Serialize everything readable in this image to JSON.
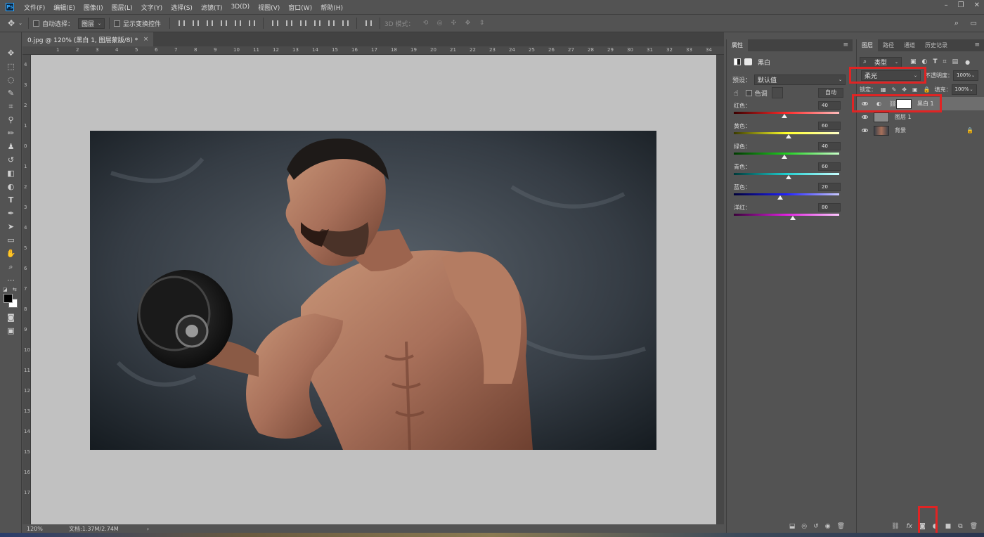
{
  "menubar": {
    "logo": "Ps",
    "items": [
      "文件(F)",
      "编辑(E)",
      "图像(I)",
      "图层(L)",
      "文字(Y)",
      "选择(S)",
      "滤镜(T)",
      "3D(D)",
      "视图(V)",
      "窗口(W)",
      "帮助(H)"
    ]
  },
  "options": {
    "auto_select_label": "自动选择：",
    "auto_select_value": "图层",
    "show_transform_label": "显示变换控件",
    "mode_3d_label": "3D 模式："
  },
  "document": {
    "tab_title": "0.jpg @ 120% (黑白 1, 图层蒙版/8) *",
    "zoom": "120%",
    "doc_info": "文档:1.37M/2.74M",
    "ruler_h": [
      "1",
      "2",
      "3",
      "4",
      "5",
      "6",
      "7",
      "8",
      "9",
      "10",
      "11",
      "12",
      "13",
      "14",
      "15",
      "16",
      "17",
      "18",
      "19",
      "20",
      "21",
      "22",
      "23",
      "24",
      "25",
      "26",
      "27",
      "28",
      "29",
      "30",
      "31",
      "32",
      "33",
      "34",
      "35"
    ],
    "ruler_v": [
      "4",
      "3",
      "2",
      "1",
      "0",
      "1",
      "2",
      "3",
      "4",
      "5",
      "6",
      "7",
      "8",
      "9",
      "10",
      "11",
      "12",
      "13",
      "14",
      "15",
      "16",
      "17"
    ]
  },
  "properties": {
    "tab": "属性",
    "adjustment_name": "黑白",
    "preset_label": "预设：",
    "preset_value": "默认值",
    "tint_label": "色调",
    "auto_button": "自动",
    "sliders": [
      {
        "label": "红色：",
        "value": "40",
        "fraction": 0.48,
        "gradient": "linear-gradient(90deg,#3a0000,#ff2a2a,#ffbcbc)"
      },
      {
        "label": "黄色：",
        "value": "60",
        "fraction": 0.52,
        "gradient": "linear-gradient(90deg,#3a3a00,#ffff2a,#ffffc8)"
      },
      {
        "label": "绿色：",
        "value": "40",
        "fraction": 0.48,
        "gradient": "linear-gradient(90deg,#003a00,#20d020,#c8ffc8)"
      },
      {
        "label": "青色：",
        "value": "60",
        "fraction": 0.52,
        "gradient": "linear-gradient(90deg,#003a3a,#20d0d0,#c8ffff)"
      },
      {
        "label": "蓝色：",
        "value": "20",
        "fraction": 0.44,
        "gradient": "linear-gradient(90deg,#00003a,#2020ff,#c8c8ff)"
      },
      {
        "label": "洋红：",
        "value": "80",
        "fraction": 0.56,
        "gradient": "linear-gradient(90deg,#3a003a,#e020e0,#ffc8ff)"
      }
    ]
  },
  "layers": {
    "tabs": [
      "图层",
      "路径",
      "通道",
      "历史记录"
    ],
    "filter_label": "类型",
    "blend_mode": "柔光",
    "opacity_label": "不透明度：",
    "opacity_value": "100%",
    "lock_label": "锁定：",
    "fill_label": "填充：",
    "fill_value": "100%",
    "items": [
      {
        "name": "黑白 1",
        "kind": "adjustment",
        "selected": true
      },
      {
        "name": "图层 1",
        "kind": "pixel",
        "selected": false
      },
      {
        "name": "背景",
        "kind": "background",
        "selected": false,
        "locked": true
      }
    ]
  },
  "colors": {
    "highlight": "#e02424",
    "panel_bg": "#535353",
    "pasteboard": "#c1c1c1"
  }
}
